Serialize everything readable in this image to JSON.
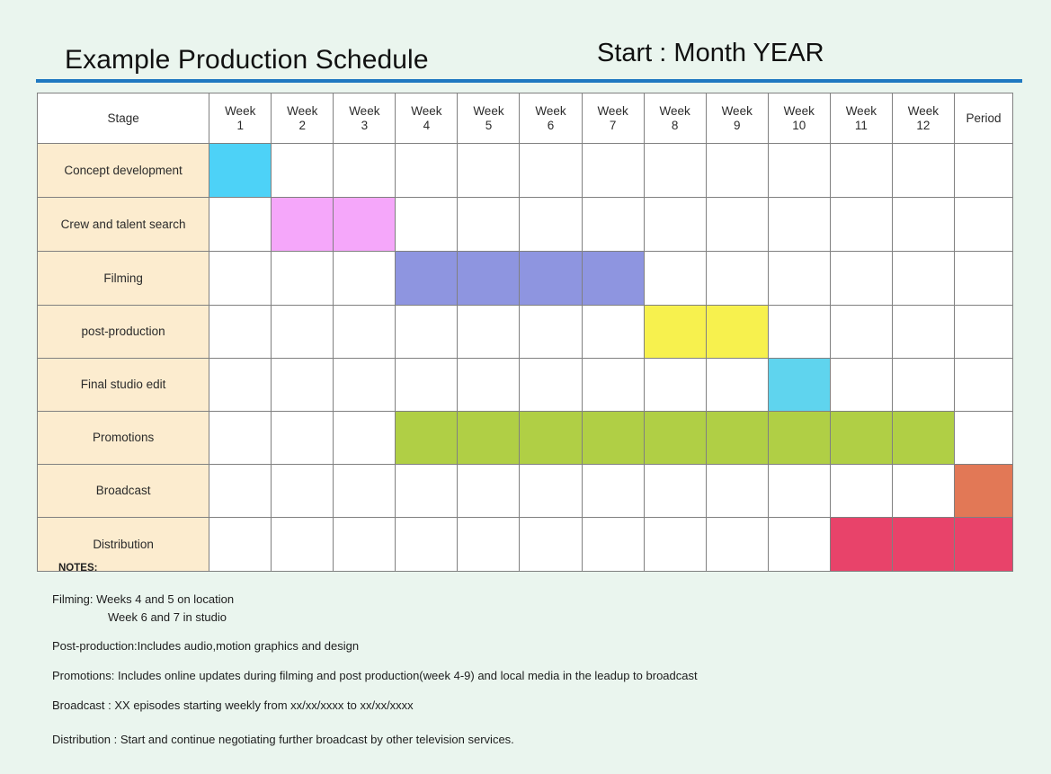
{
  "header": {
    "title": "Example Production Schedule",
    "start_label": "Start : Month   YEAR",
    "rule_color": "#1f78c1"
  },
  "palette": {
    "background": "#eaf5ee",
    "header_cell": "#c5d4f2",
    "stage_cell": "#fceccf",
    "grid_line": "#808080",
    "cyan": "#4dd2f7",
    "cyan_alt": "#5fd4ee",
    "pink": "#f5a7fa",
    "purple": "#8e95e0",
    "yellow": "#f7f14e",
    "green": "#b0cf45",
    "orange": "#e27856",
    "red": "#e8436a"
  },
  "table": {
    "stage_header": "Stage",
    "week_prefix": "Week",
    "week_numbers": [
      "1",
      "2",
      "3",
      "4",
      "5",
      "6",
      "7",
      "8",
      "9",
      "10",
      "11",
      "12"
    ],
    "period_header": "Period",
    "rows": [
      {
        "stage": "Concept development",
        "bars": [
          {
            "start": 1,
            "end": 1,
            "color": "#4dd2f7"
          }
        ]
      },
      {
        "stage": "Crew and talent search",
        "bars": [
          {
            "start": 2,
            "end": 3,
            "color": "#f5a7fa"
          }
        ]
      },
      {
        "stage": "Filming",
        "bars": [
          {
            "start": 4,
            "end": 7,
            "color": "#8e95e0"
          }
        ]
      },
      {
        "stage": "post-production",
        "bars": [
          {
            "start": 8,
            "end": 9,
            "color": "#f7f14e"
          }
        ]
      },
      {
        "stage": "Final studio edit",
        "bars": [
          {
            "start": 10,
            "end": 10,
            "color": "#5fd4ee"
          }
        ]
      },
      {
        "stage": "Promotions",
        "bars": [
          {
            "start": 4,
            "end": 12,
            "color": "#b0cf45"
          }
        ]
      },
      {
        "stage": "Broadcast",
        "bars": [
          {
            "start": 13,
            "end": 13,
            "color": "#e27856"
          }
        ]
      },
      {
        "stage": "Distribution",
        "bars": [
          {
            "start": 11,
            "end": 13,
            "color": "#e8436a"
          }
        ]
      }
    ]
  },
  "notes": {
    "title": "NOTES:",
    "lines": [
      "Filming:  Weeks 4 and 5 on location",
      "Week 6 and 7 in studio",
      "Post-production:Includes audio,motion graphics and design",
      "Promotions: Includes online updates  during filming and post production(week 4-9) and local media in the leadup to broadcast",
      "Broadcast : XX episodes starting weekly from xx/xx/xxxx to xx/xx/xxxx",
      "Distribution : Start and  continue negotiating further broadcast by other television services."
    ]
  }
}
